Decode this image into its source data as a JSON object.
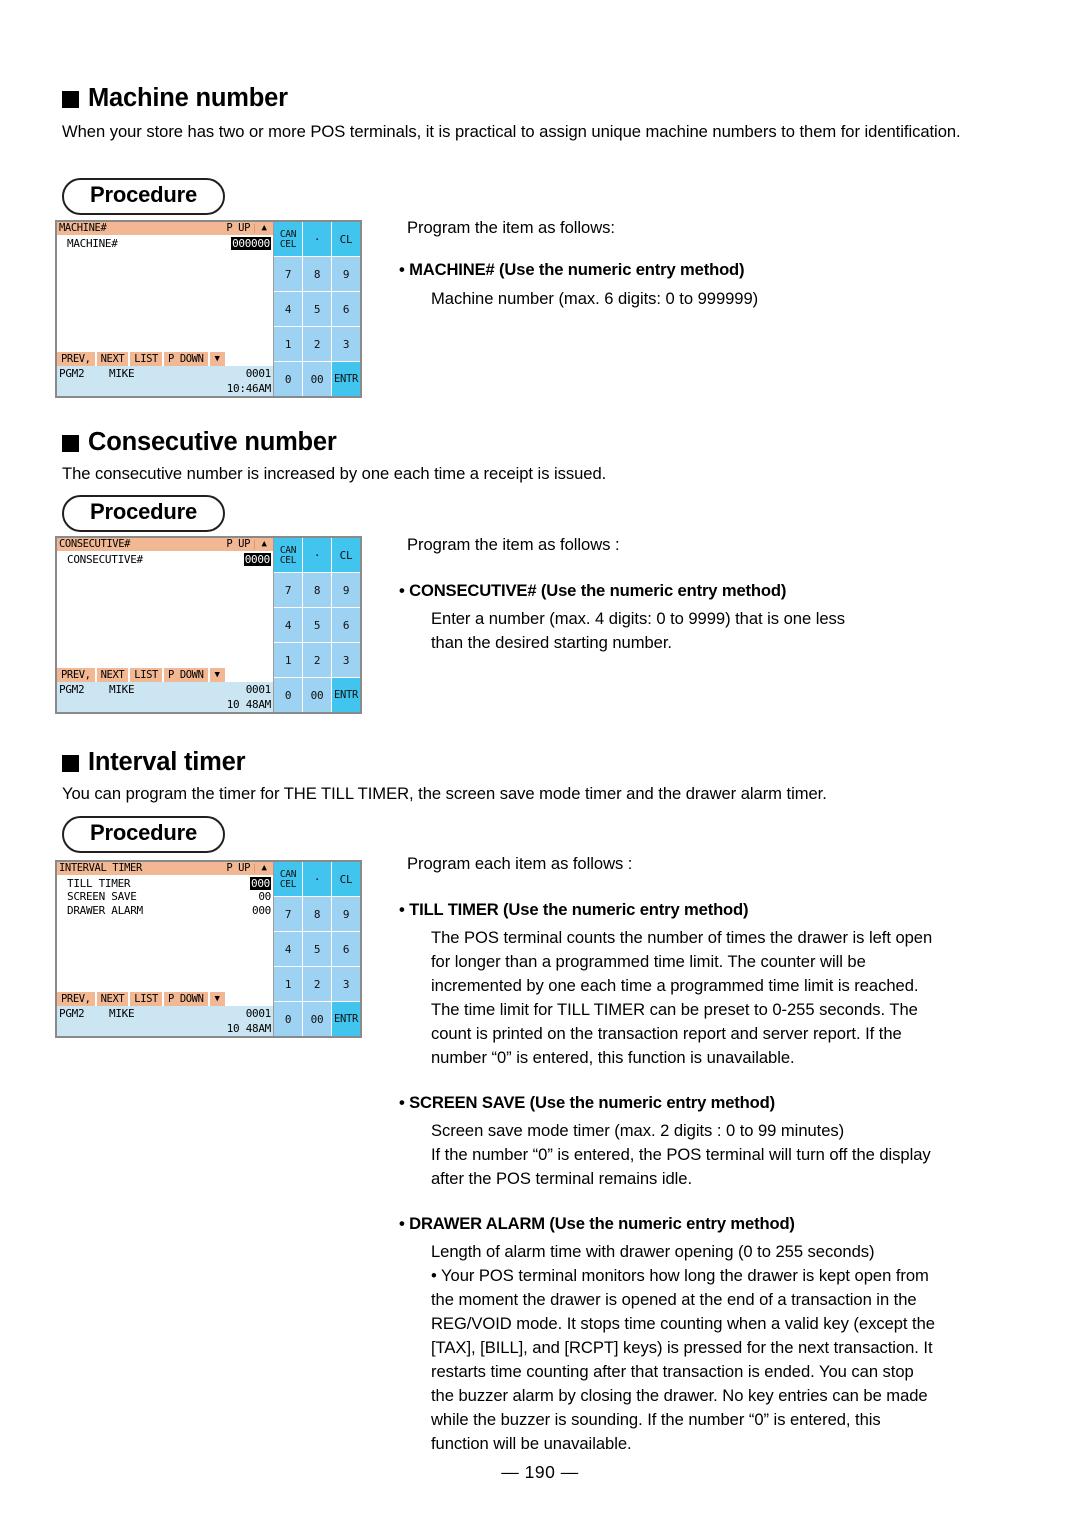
{
  "page": {
    "number_label": "— 190 —"
  },
  "sections": [
    {
      "heading": "Machine number",
      "intro": "When your store has two or more POS terminals, it is practical to assign unique machine numbers to them for identification.",
      "procedure_label": "Procedure",
      "lead": "Program the item as follows:",
      "bullets": [
        {
          "title": "• MACHINE# (Use the numeric entry method)",
          "lines": [
            "Machine number (max. 6 digits: 0 to 999999)"
          ]
        }
      ],
      "screen": {
        "title": "MACHINE#",
        "page_up_label": "P UP",
        "up_arrow": "▲",
        "down_arrow": "▼",
        "rows": [
          {
            "label": "MACHINE#",
            "value": "000000",
            "highlighted": true
          }
        ],
        "function_keys": [
          "PREV,",
          "NEXT",
          "LIST",
          "P DOWN"
        ],
        "status": {
          "mode": "PGM2",
          "user": "MIKE",
          "counter": "0001",
          "time": "10:46AM"
        },
        "keypad": [
          {
            "label": "CANCEL",
            "style": "accent-cancel"
          },
          {
            "label": "·",
            "style": "accent"
          },
          {
            "label": "CL",
            "style": "accent"
          },
          {
            "label": "7",
            "style": "num"
          },
          {
            "label": "8",
            "style": "num"
          },
          {
            "label": "9",
            "style": "num"
          },
          {
            "label": "4",
            "style": "num"
          },
          {
            "label": "5",
            "style": "num"
          },
          {
            "label": "6",
            "style": "num"
          },
          {
            "label": "1",
            "style": "num"
          },
          {
            "label": "2",
            "style": "num"
          },
          {
            "label": "3",
            "style": "num"
          },
          {
            "label": "0",
            "style": "num"
          },
          {
            "label": "00",
            "style": "num"
          },
          {
            "label": "ENTR",
            "style": "accent"
          }
        ]
      }
    },
    {
      "heading": "Consecutive number",
      "intro": "The consecutive number is increased by one each time a receipt is issued.",
      "procedure_label": "Procedure",
      "lead": "Program the item as follows   :",
      "bullets": [
        {
          "title": "• CONSECUTIVE# (Use the numeric entry method)",
          "lines": [
            "Enter a number (max. 4 digits: 0 to 9999) that is one less",
            "than the desired starting number."
          ]
        }
      ],
      "screen": {
        "title": "CONSECUTIVE#",
        "page_up_label": "P UP",
        "up_arrow": "▲",
        "down_arrow": "▼",
        "rows": [
          {
            "label": "CONSECUTIVE#",
            "value": "0000",
            "highlighted": true
          }
        ],
        "function_keys": [
          "PREV,",
          "NEXT",
          "LIST",
          "P DOWN"
        ],
        "status": {
          "mode": "PGM2",
          "user": "MIKE",
          "counter": "0001",
          "time": "10 48AM"
        }
      }
    },
    {
      "heading": "Interval timer",
      "intro": "You can program the timer for THE TILL TIMER, the screen save mode timer and the drawer alarm timer.",
      "procedure_label": "Procedure",
      "lead": "Program each item as follows :",
      "bullets": [
        {
          "title": "• TILL TIMER (Use the numeric entry method)",
          "lines": [
            "The POS terminal counts the number of times the drawer is left open",
            "for longer than a programmed time limit. The counter will be",
            "incremented by one each time a programmed time limit is reached.",
            "The time limit for TILL TIMER can be preset to 0-255 seconds. The",
            "count is printed on the transaction report and server report. If the",
            "number “0” is entered, this function is unavailable."
          ]
        },
        {
          "title": "• SCREEN SAVE (Use the numeric entry method)",
          "lines": [
            "Screen save mode timer (max. 2 digits : 0 to 99 minutes)",
            "If the number “0” is entered, the POS terminal will turn off the display",
            "after the POS terminal remains idle."
          ]
        },
        {
          "title": "• DRAWER ALARM (Use the numeric entry method)",
          "lines": [
            "Length of alarm time with drawer opening (0 to 255 seconds)",
            "• Your POS terminal monitors how long the drawer is kept open from",
            "the moment the drawer is opened at the end of a transaction in the",
            "REG/VOID mode. It stops time counting when a valid key (except the",
            "[TAX], [BILL], and [RCPT] keys) is pressed for the next transaction. It",
            "restarts time counting after that transaction is ended. You can stop",
            "the buzzer alarm by closing the drawer. No key entries can be made",
            "while the buzzer is sounding. If the number “0” is entered, this",
            "function will be unavailable."
          ]
        }
      ],
      "screen": {
        "title": "INTERVAL TIMER",
        "page_up_label": "P UP",
        "up_arrow": "▲",
        "down_arrow": "▼",
        "rows": [
          {
            "label": "TILL TIMER",
            "value": "000",
            "highlighted": true
          },
          {
            "label": "SCREEN SAVE",
            "value": "00",
            "highlighted": false
          },
          {
            "label": "DRAWER ALARM",
            "value": "000",
            "highlighted": false
          }
        ],
        "function_keys": [
          "PREV,",
          "NEXT",
          "LIST",
          "P DOWN"
        ],
        "status": {
          "mode": "PGM2",
          "user": "MIKE",
          "counter": "0001",
          "time": "10 48AM"
        }
      }
    }
  ],
  "colors": {
    "titlebar": "#f2b894",
    "status_bar": "#cbe6f2",
    "key_number": "#9ed2f2",
    "key_accent": "#41c4ee"
  }
}
